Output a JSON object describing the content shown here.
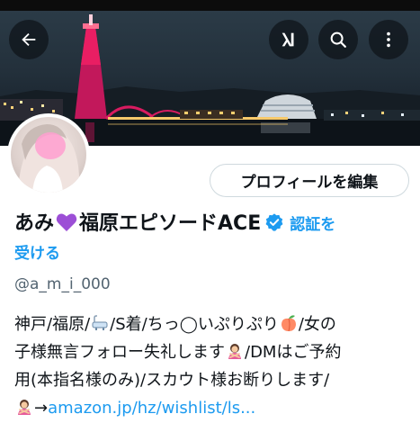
{
  "header": {
    "back_icon": "arrow-left-icon",
    "grok_icon": "grok-icon",
    "search_icon": "search-icon",
    "more_icon": "more-vertical-icon"
  },
  "profile": {
    "edit_button": "プロフィールを編集",
    "name_part1": "あみ",
    "name_part2": "福原エピソードACE",
    "verify_label_1": "認証を",
    "verify_label_2": "受ける",
    "handle": "@a_m_i_000",
    "bio": {
      "line1_a": "神戸/福原/",
      "line1_b": "/S着/ちっ◯いぷりぷり",
      "line1_c": "/女の",
      "line2_a": "子様無言フォロー失礼します",
      "line2_b": "/DMはご予約",
      "line3": "用(本指名様のみ)/スカウト様お断りします/",
      "line4_arrow": "→",
      "line4_link": "amazon.jp/hz/wishlist/ls..."
    }
  },
  "colors": {
    "accent": "#1d9bf0",
    "secondary_text": "#536471",
    "border": "#cfd9de"
  }
}
